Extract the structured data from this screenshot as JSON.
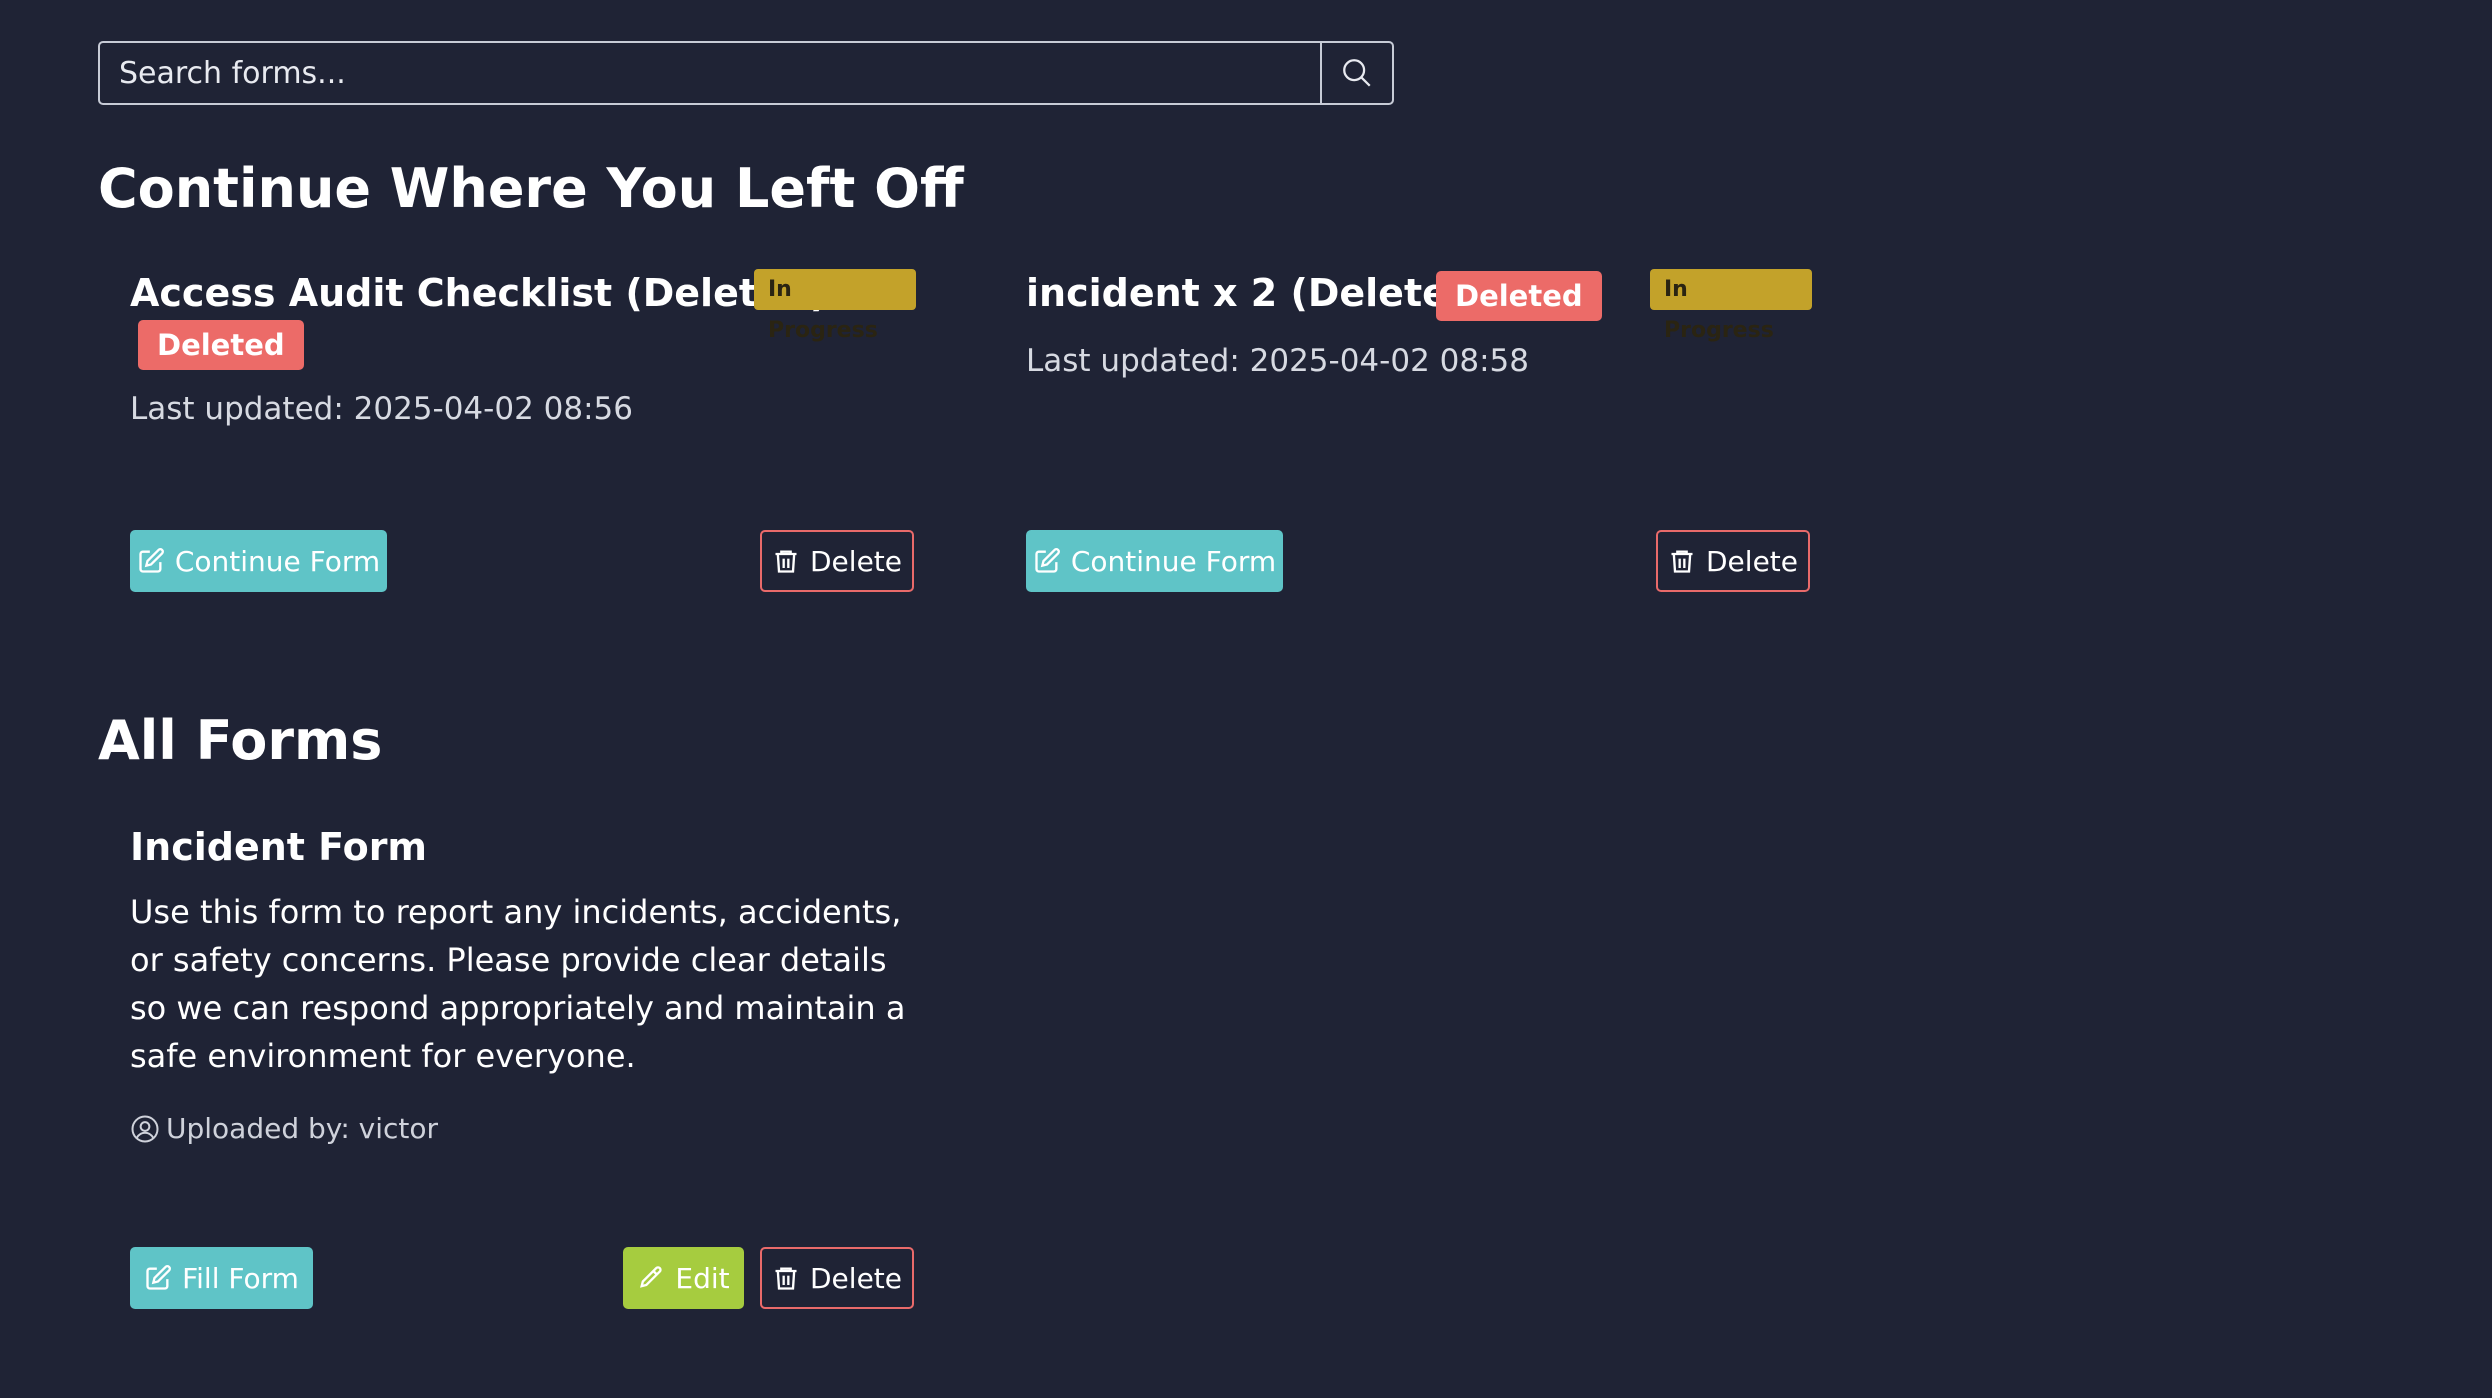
{
  "search": {
    "placeholder": "Search forms..."
  },
  "sections": {
    "continue_title": "Continue Where You Left Off",
    "all_title": "All Forms"
  },
  "in_progress": [
    {
      "title": "Access Audit Checklist (Deleted)",
      "status_badge": "In Progress",
      "deleted_badge": "Deleted",
      "last_updated": "Last updated: 2025-04-02 08:56",
      "continue_label": "Continue Form",
      "delete_label": "Delete"
    },
    {
      "title": "incident x 2 (Deleted)",
      "status_badge": "In Progress",
      "deleted_badge": "Deleted",
      "last_updated": "Last updated: 2025-04-02 08:58",
      "continue_label": "Continue Form",
      "delete_label": "Delete"
    }
  ],
  "forms": [
    {
      "title": "Incident Form",
      "description": "Use this form to report any incidents, accidents, or safety concerns. Please provide clear details so we can respond appropriately and maintain a safe environment for everyone.",
      "uploaded_by": "Uploaded by: victor",
      "fill_label": "Fill Form",
      "edit_label": "Edit",
      "delete_label": "Delete"
    }
  ],
  "colors": {
    "background": "#1f2335",
    "teal_button": "#5fc4c7",
    "green_button": "#a6cc3f",
    "danger": "#e96a6a",
    "in_progress_badge": "#c3a22a"
  }
}
